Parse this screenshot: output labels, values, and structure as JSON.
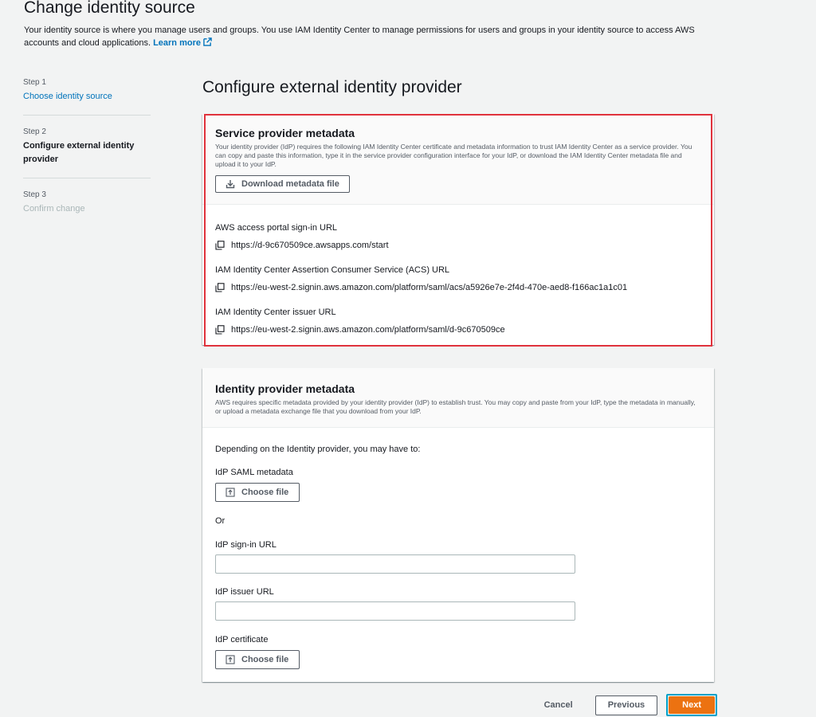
{
  "page": {
    "title": "Change identity source",
    "description": "Your identity source is where you manage users and groups. You use IAM Identity Center to manage permissions for users and groups in your identity source to access AWS accounts and cloud applications.",
    "learn_more": "Learn more"
  },
  "steps": [
    {
      "num": "Step 1",
      "title": "Choose identity source",
      "state": "link"
    },
    {
      "num": "Step 2",
      "title": "Configure external identity provider",
      "state": "current"
    },
    {
      "num": "Step 3",
      "title": "Confirm change",
      "state": "disabled"
    }
  ],
  "section_title": "Configure external identity provider",
  "sp_metadata": {
    "title": "Service provider metadata",
    "description": "Your identity provider (IdP) requires the following IAM Identity Center certificate and metadata information to trust IAM Identity Center as a service provider. You can copy and paste this information, type it in the service provider configuration interface for your IdP, or download the IAM Identity Center metadata file and upload it to your IdP.",
    "download_button": "Download metadata file",
    "fields": [
      {
        "label": "AWS access portal sign-in URL",
        "value": "https://d-9c670509ce.awsapps.com/start"
      },
      {
        "label": "IAM Identity Center Assertion Consumer Service (ACS) URL",
        "value": "https://eu-west-2.signin.aws.amazon.com/platform/saml/acs/a5926e7e-2f4d-470e-aed8-f166ac1a1c01"
      },
      {
        "label": "IAM Identity Center issuer URL",
        "value": "https://eu-west-2.signin.aws.amazon.com/platform/saml/d-9c670509ce"
      }
    ]
  },
  "idp_metadata": {
    "title": "Identity provider metadata",
    "description": "AWS requires specific metadata provided by your identity provider (IdP) to establish trust. You may copy and paste from your IdP, type the metadata in manually, or upload a metadata exchange file that you download from your IdP.",
    "intro": "Depending on the Identity provider, you may have to:",
    "saml_label": "IdP SAML metadata",
    "choose_file": "Choose file",
    "or": "Or",
    "signin_label": "IdP sign-in URL",
    "signin_value": "",
    "issuer_label": "IdP issuer URL",
    "issuer_value": "",
    "cert_label": "IdP certificate"
  },
  "footer": {
    "cancel": "Cancel",
    "previous": "Previous",
    "next": "Next"
  },
  "colors": {
    "link": "#0073bb",
    "primary": "#ec7211",
    "highlight": "#e0323c",
    "focus": "#00a1c9"
  }
}
